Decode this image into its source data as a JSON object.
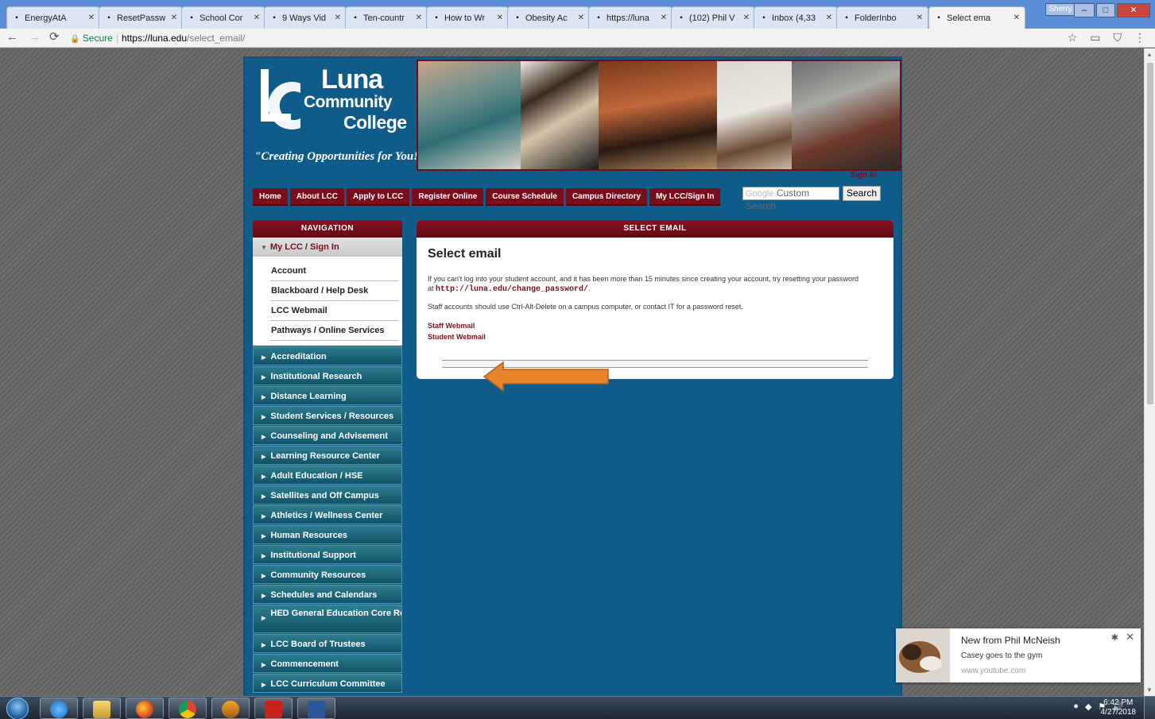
{
  "browser": {
    "tabs": [
      {
        "label": "EnergyAtA",
        "icon": "energy-icon",
        "active": false
      },
      {
        "label": "ResetPassw",
        "icon": "reset-icon",
        "active": false
      },
      {
        "label": "School Cor",
        "icon": "doc-icon",
        "active": false
      },
      {
        "label": "9 Ways Vid",
        "icon": "video-icon",
        "active": false
      },
      {
        "label": "Ten-countr",
        "icon": "bp-icon",
        "active": false
      },
      {
        "label": "How to Wr",
        "icon": "howto-icon",
        "active": false
      },
      {
        "label": "Obesity Ac",
        "icon": "oac-icon",
        "active": false
      },
      {
        "label": "https://luna",
        "icon": "doc-icon",
        "active": false
      },
      {
        "label": "(102) Phil V",
        "icon": "youtube-icon",
        "active": false
      },
      {
        "label": "Inbox (4,33",
        "icon": "gmail-icon",
        "active": false
      },
      {
        "label": "FolderInbo",
        "icon": "blackboard-icon",
        "active": false
      },
      {
        "label": "Select ema",
        "icon": "doc-icon",
        "active": true
      }
    ],
    "profile": "Sherry",
    "address": {
      "secure": "Secure",
      "host": "https://luna.edu",
      "path": "/select_email/"
    }
  },
  "site": {
    "logo": {
      "luna": "Luna",
      "community": "Community",
      "college": "College",
      "tagline": "\"Creating Opportunities for You!\""
    },
    "sign_in": "Sign In",
    "menu": [
      "Home",
      "About LCC",
      "Apply to LCC",
      "Register Online",
      "Course Schedule",
      "Campus Directory",
      "My LCC/Sign In"
    ],
    "search": {
      "brand": "Google",
      "placeholder": "Custom Search",
      "button": "Search"
    },
    "nav": {
      "heading": "NAVIGATION",
      "section": "My LCC / Sign In",
      "sub_items": [
        "Account",
        "Blackboard / Help Desk",
        "LCC Webmail",
        "Pathways / Online Services"
      ],
      "items": [
        "Accreditation",
        "Institutional Research",
        "Distance Learning",
        "Student Services / Resources",
        "Counseling and Advisement",
        "Learning Resource Center",
        "Adult Education / HSE",
        "Satellites and Off Campus",
        "Athletics / Wellness Center",
        "Human Resources",
        "Institutional Support",
        "Community Resources",
        "Schedules and Calendars",
        "HED General Education Core Reporting",
        "LCC Board of Trustees",
        "Commencement",
        "LCC Curriculum Committee"
      ]
    },
    "panel": {
      "heading": "SELECT EMAIL",
      "title": "Select email",
      "p1_before": "If you can't log into your student account, and it has been more than 15 minutes since creating your account, try resetting your password at ",
      "p1_link": "http://luna.edu/change_password/",
      "p1_after": ".",
      "p2": "Staff accounts should use Ctrl-Alt-Delete on a campus computer, or contact IT for a password reset.",
      "link_staff": "Staff Webmail",
      "link_student": "Student Webmail"
    }
  },
  "notification": {
    "title": "New from Phil McNeish",
    "body": "Casey goes to the gym",
    "site": "www.youtube.com"
  },
  "taskbar": {
    "time": "6:42 PM",
    "date": "4/27/2018"
  },
  "colors": {
    "maroon": "#7a0d1c",
    "site_blue": "#0f5b8a",
    "nav_teal": "#1f6a80",
    "arrow_orange": "#e8852a"
  }
}
